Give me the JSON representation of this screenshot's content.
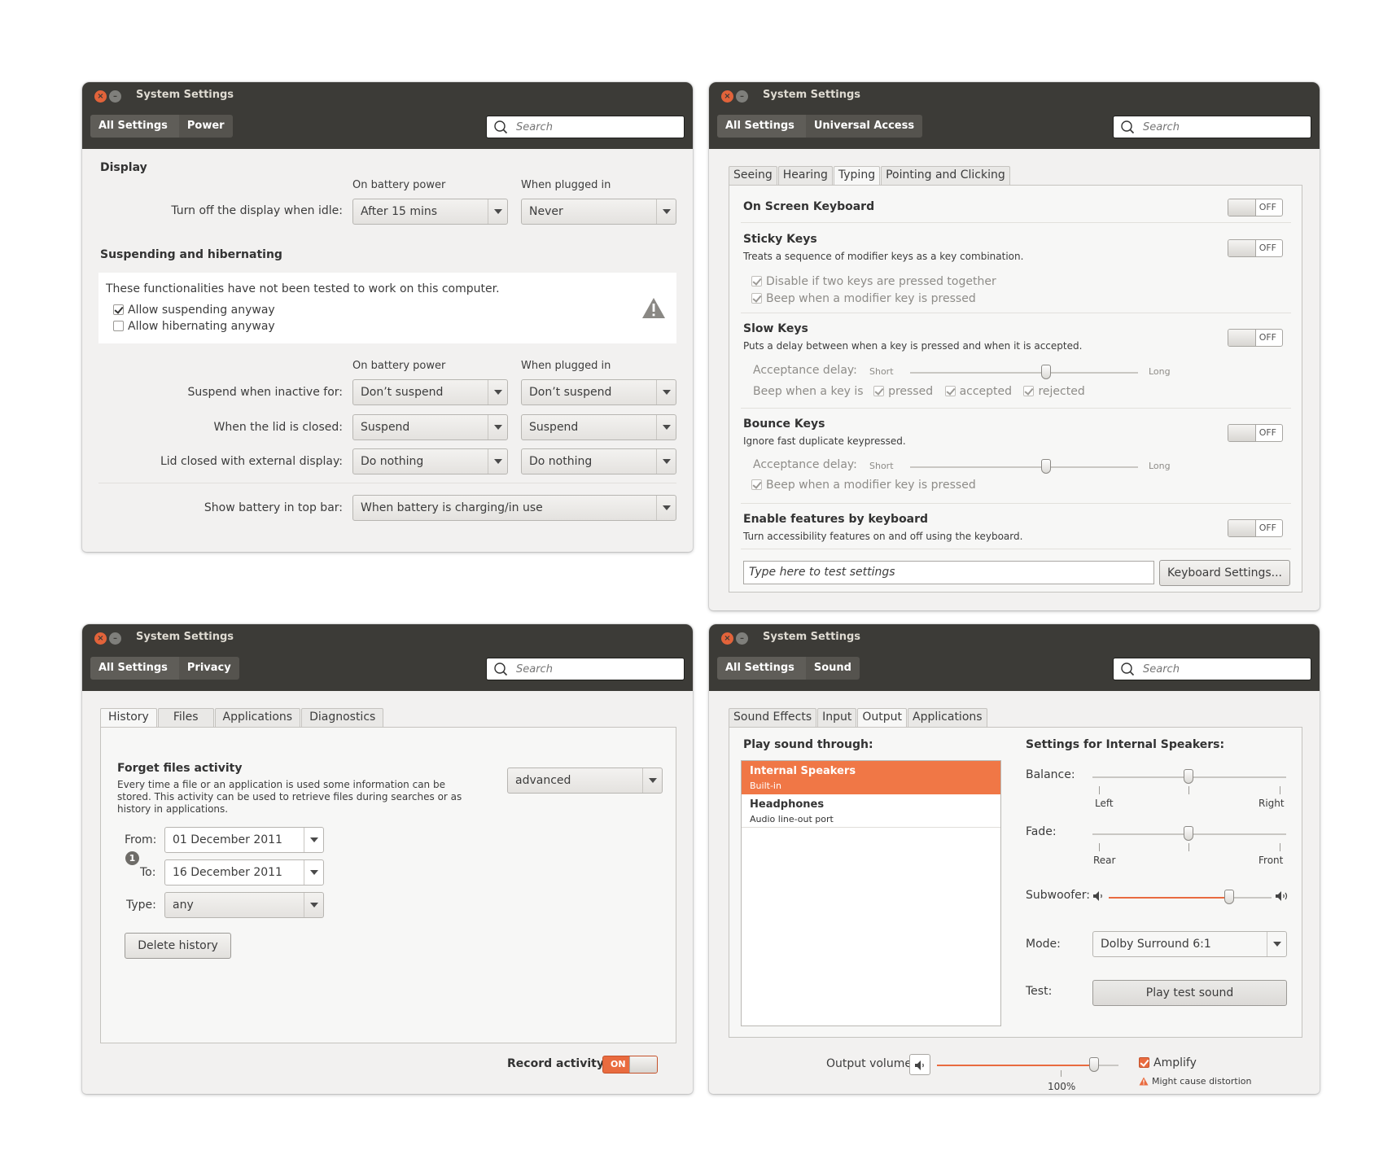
{
  "windows": {
    "power": {
      "title": "System Settings",
      "crumbs": [
        "All Settings",
        "Power"
      ],
      "search_placeholder": "Search",
      "display_heading": "Display",
      "col_battery": "On battery power",
      "col_plugged": "When plugged in",
      "turn_off_label": "Turn off the display when idle:",
      "turn_off_battery": "After 15 mins",
      "turn_off_plugged": "Never",
      "suspend_heading": "Suspending and hibernating",
      "warning_text": "These functionalities have not been tested to work on this computer.",
      "allow_suspend": "Allow suspending anyway",
      "allow_hibernate": "Allow hibernating anyway",
      "col_battery2": "On battery power",
      "col_plugged2": "When plugged in",
      "inactive_label": "Suspend when inactive for:",
      "inactive_battery": "Don’t suspend",
      "inactive_plugged": "Don’t suspend",
      "lid_label": "When the lid is closed:",
      "lid_battery": "Suspend",
      "lid_plugged": "Suspend",
      "ext_label": "Lid closed with external display:",
      "ext_battery": "Do nothing",
      "ext_plugged": "Do nothing",
      "show_battery_label": "Show battery in top bar:",
      "show_battery_value": "When  battery is charging/in use"
    },
    "access": {
      "title": "System Settings",
      "crumbs": [
        "All Settings",
        "Universal Access"
      ],
      "search_placeholder": "Search",
      "tabs": [
        "Seeing",
        "Hearing",
        "Typing",
        "Pointing and Clicking"
      ],
      "osk_title": "On Screen Keyboard",
      "sticky_title": "Sticky Keys",
      "sticky_desc": "Treats a sequence of modifier keys as a key combination.",
      "sticky_opt1": "Disable if two keys are pressed together",
      "sticky_opt2": "Beep when a modifier key is pressed",
      "slow_title": "Slow Keys",
      "slow_desc": "Puts a delay between when a key is pressed and when it is accepted.",
      "slow_delay": "Acceptance delay:",
      "short": "Short",
      "long": "Long",
      "beep_when": "Beep when a key is",
      "pressed": "pressed",
      "accepted": "accepted",
      "rejected": "rejected",
      "bounce_title": "Bounce Keys",
      "bounce_desc": "Ignore fast duplicate keypressed.",
      "bounce_delay": "Acceptance delay:",
      "short2": "Short",
      "long2": "Long",
      "bounce_beep": "Beep when a modifier key is pressed",
      "enable_title": "Enable features by keyboard",
      "enable_desc": "Turn accessibility features on and off using the keyboard.",
      "off": "OFF",
      "test_placeholder": "Type here to test settings",
      "keyboard_settings": "Keyboard Settings..."
    },
    "privacy": {
      "title": "System Settings",
      "crumbs": [
        "All Settings",
        "Privacy"
      ],
      "search_placeholder": "Search",
      "tabs": [
        "History",
        "Files",
        "Applications",
        "Diagnostics"
      ],
      "forget_title": "Forget files activity",
      "forget_desc": "Every time a file or an application is used some information can be stored. This activity can be used to retrieve files during searches or as history in applications.",
      "mode_value": "advanced",
      "from_label": "From:",
      "from_value": "01 December 2011",
      "to_label": "To:",
      "to_value": "16 December 2011",
      "badge": "1",
      "type_label": "Type:",
      "type_value": "any",
      "delete_button": "Delete history",
      "record_label": "Record activity",
      "on": "ON"
    },
    "sound": {
      "title": "System Settings",
      "crumbs": [
        "All Settings",
        "Sound"
      ],
      "search_placeholder": "Search",
      "tabs": [
        "Sound Effects",
        "Input",
        "Output",
        "Applications"
      ],
      "play_through": "Play sound through:",
      "devices": [
        {
          "name": "Internal Speakers",
          "sub": "Built-in"
        },
        {
          "name": "Headphones",
          "sub": "Audio line-out port"
        }
      ],
      "settings_for": "Settings for Internal Speakers:",
      "balance_label": "Balance:",
      "left": "Left",
      "right": "Right",
      "fade_label": "Fade:",
      "rear": "Rear",
      "front": "Front",
      "subwoofer_label": "Subwoofer:",
      "mode_label": "Mode:",
      "mode_value": "Dolby Surround 6:1",
      "test_label": "Test:",
      "test_button": "Play test sound",
      "output_volume_label": "Output volume:",
      "volume_percent": "100%",
      "amplify": "Amplify",
      "distortion": "Might cause distortion"
    }
  },
  "colors": {
    "titlebar": "#3c3b37",
    "accent": "#e96b3f",
    "window_bg": "#f2f1f0"
  }
}
